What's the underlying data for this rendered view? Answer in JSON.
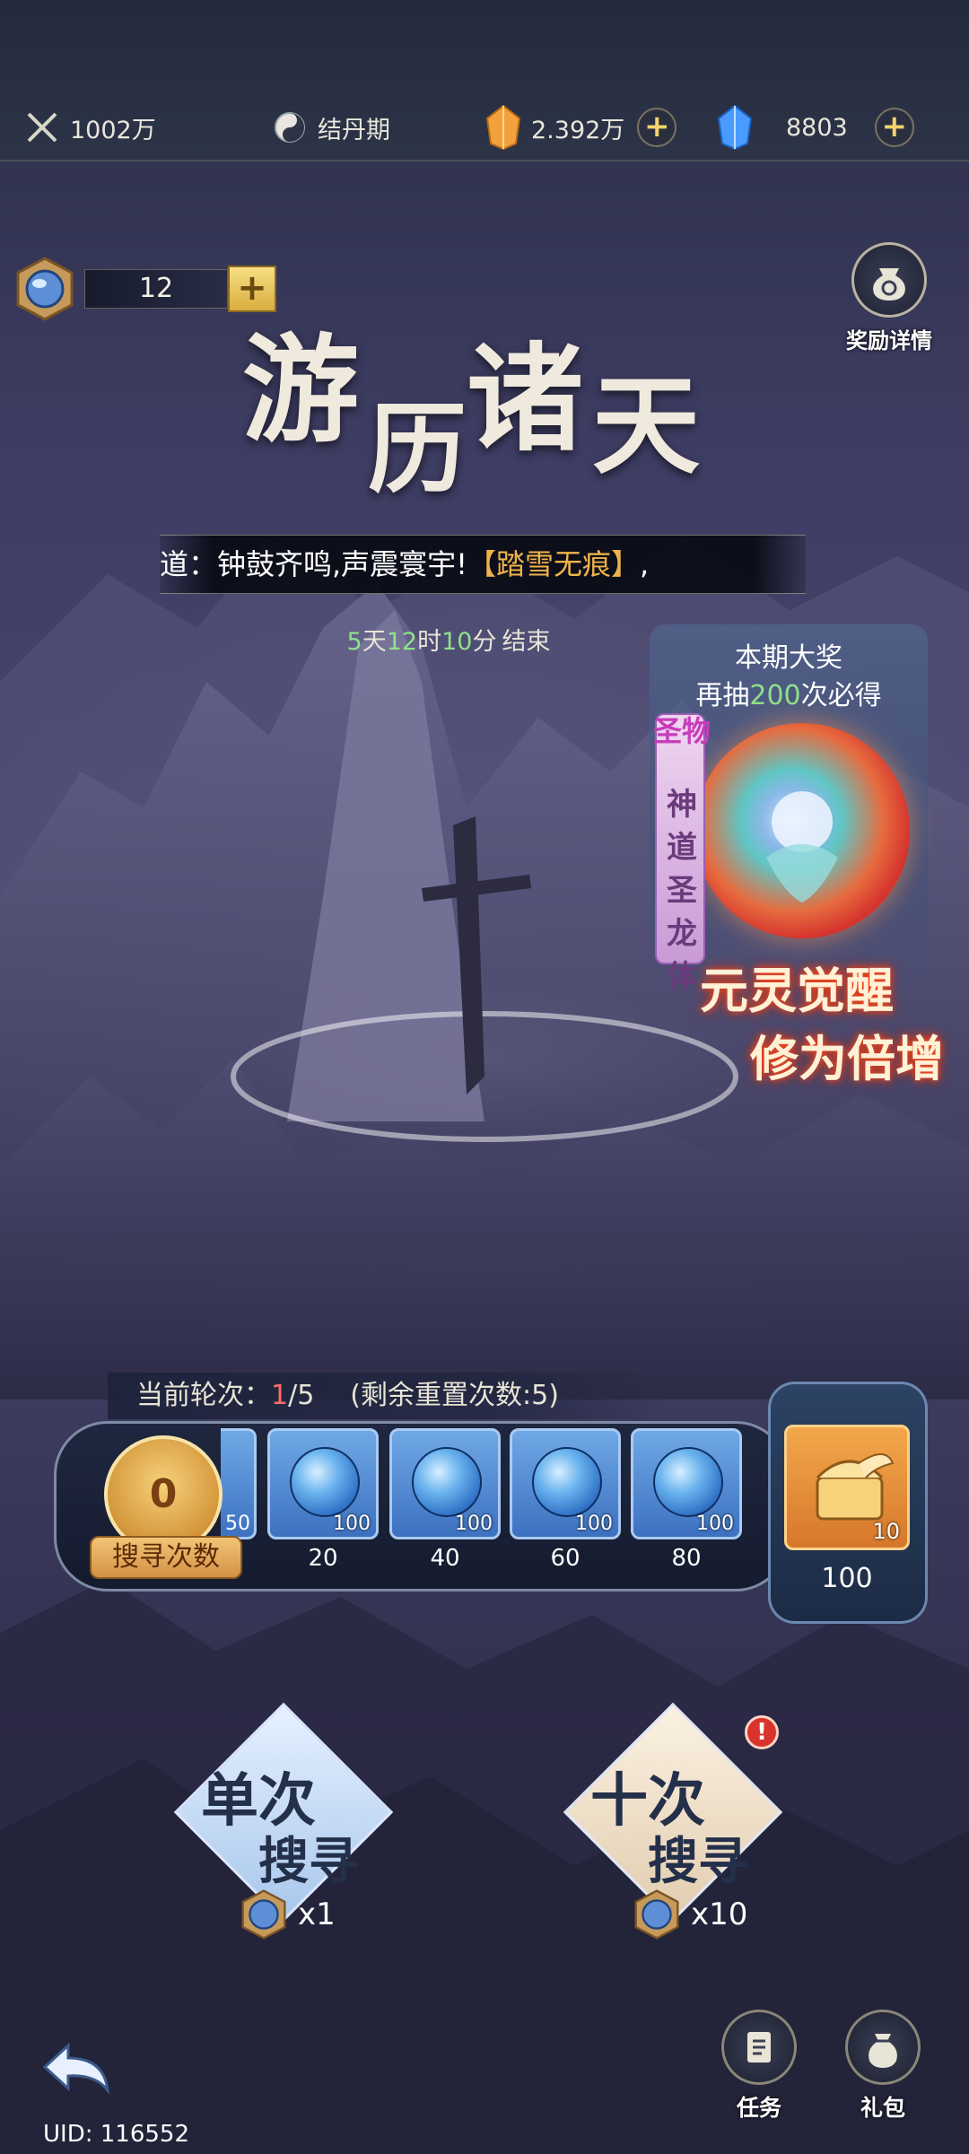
{
  "topbar": {
    "power": "1002万",
    "realm": "结丹期",
    "gold": "2.392万",
    "gems": "8803"
  },
  "token": {
    "count": "12"
  },
  "reward_detail": {
    "label": "奖励详情"
  },
  "title": {
    "c1": "游",
    "c2": "历",
    "c3": "诸",
    "c4": "天"
  },
  "marquee": {
    "text": "道：钟鼓齐鸣,声震寰宇!",
    "highlight": "【踏雪无痕】",
    "tail": ","
  },
  "countdown": {
    "d": "5",
    "d_unit": "天",
    "h": "12",
    "h_unit": "时",
    "m": "10",
    "m_unit": "分",
    "suffix": "结束"
  },
  "grand_prize": {
    "line1": "本期大奖",
    "line2_prefix": "再抽",
    "line2_num": "200",
    "line2_suffix": "次必得",
    "tag": "圣物",
    "name": "神道圣龙体",
    "promo_line1": "元灵觉醒",
    "promo_line2": "修为倍增"
  },
  "progress": {
    "round_label": "当前轮次：",
    "round_current": "1",
    "round_total": "/5",
    "reset_text": "(剩余重置次数:5)",
    "search_count": "0",
    "search_count_label": "搜寻次数",
    "partial_qty": "50",
    "milestones": [
      {
        "qty": "100",
        "threshold": "20"
      },
      {
        "qty": "100",
        "threshold": "40"
      },
      {
        "qty": "100",
        "threshold": "60"
      },
      {
        "qty": "100",
        "threshold": "80"
      }
    ],
    "final": {
      "qty": "10",
      "threshold": "100"
    }
  },
  "search": {
    "single": {
      "line1": "单次",
      "line2": "搜寻",
      "cost": "x1"
    },
    "ten": {
      "line1": "十次",
      "line2": "搜寻",
      "cost": "x10"
    },
    "alert": "!"
  },
  "bottom": {
    "uid": "UID: 116552",
    "task_label": "任务",
    "gift_label": "礼包"
  }
}
